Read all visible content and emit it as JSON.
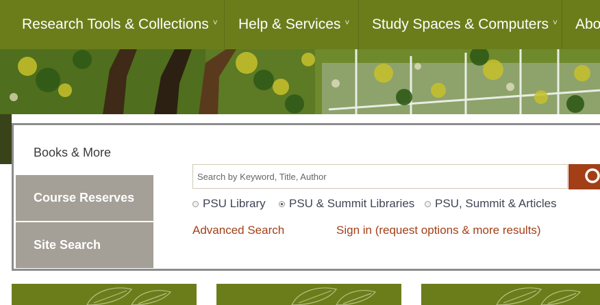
{
  "nav": {
    "items": [
      {
        "label": "Research Tools & Collections",
        "caret": "˅"
      },
      {
        "label": "Help & Services",
        "caret": "˅"
      },
      {
        "label": "Study Spaces & Computers",
        "caret": "˅"
      },
      {
        "label": "Abo",
        "caret": ""
      }
    ]
  },
  "search": {
    "tabs": [
      {
        "label": "Books & More",
        "active": true
      },
      {
        "label": "Course Reserves",
        "active": false
      },
      {
        "label": "Site Search",
        "active": false
      }
    ],
    "placeholder": "Search by Keyword, Title, Author",
    "button_icon": "search-icon",
    "scopes": [
      {
        "label": "PSU Library",
        "checked": false
      },
      {
        "label": "PSU & Summit Libraries",
        "checked": true
      },
      {
        "label": "PSU, Summit & Articles",
        "checked": false
      }
    ],
    "advanced_link": "Advanced Search",
    "signin_link": "Sign in (request options & more results)"
  },
  "colors": {
    "nav_green": "#6b7d1b",
    "accent_rust": "#a23f17",
    "tab_gray": "#a4a097"
  },
  "hero_image": "campus-trees-photo",
  "cards": [
    "leaf-pattern-card",
    "leaf-pattern-card",
    "leaf-pattern-card"
  ]
}
